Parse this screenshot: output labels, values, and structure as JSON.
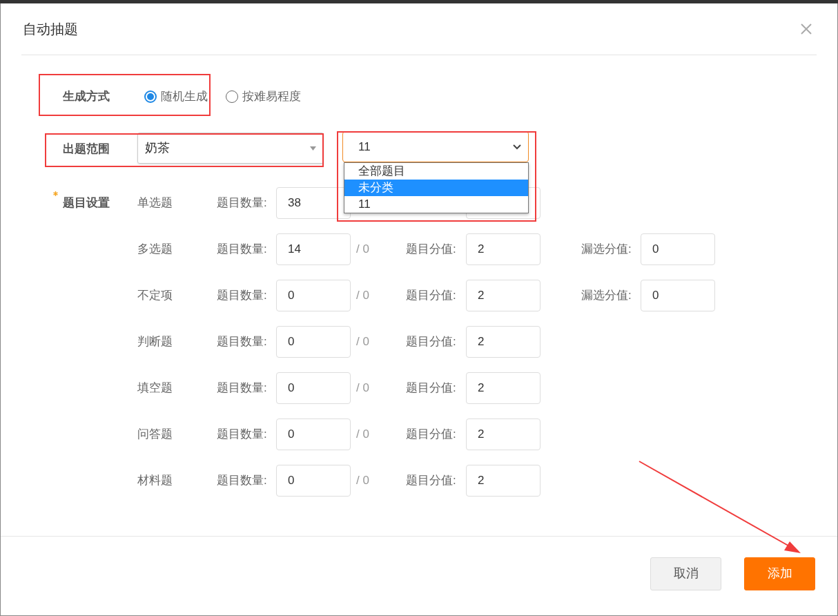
{
  "dialog": {
    "title": "自动抽题"
  },
  "mode": {
    "label": "生成方式",
    "options": [
      {
        "label": "随机生成",
        "selected": true
      },
      {
        "label": "按难易程度",
        "selected": false
      }
    ]
  },
  "scope": {
    "label": "出题范围",
    "bank_select": {
      "value": "奶茶"
    },
    "category_select": {
      "value": "11",
      "expanded": true,
      "options": [
        {
          "label": "全部题目",
          "highlighted": false
        },
        {
          "label": "未分类",
          "highlighted": true
        },
        {
          "label": "11",
          "highlighted": false
        }
      ]
    }
  },
  "questions": {
    "label": "题目设置",
    "required": true,
    "rows": [
      {
        "type": "单选题",
        "count_label": "题目数量:",
        "count": "38",
        "score_field": true
      },
      {
        "type": "多选题",
        "count_label": "题目数量:",
        "count": "14",
        "total": "/ 0",
        "score_label": "题目分值:",
        "score": "2",
        "partial_label": "漏选分值:",
        "partial": "0"
      },
      {
        "type": "不定项",
        "count_label": "题目数量:",
        "count": "0",
        "total": "/ 0",
        "score_label": "题目分值:",
        "score": "2",
        "partial_label": "漏选分值:",
        "partial": "0"
      },
      {
        "type": "判断题",
        "count_label": "题目数量:",
        "count": "0",
        "total": "/ 0",
        "score_label": "题目分值:",
        "score": "2"
      },
      {
        "type": "填空题",
        "count_label": "题目数量:",
        "count": "0",
        "total": "/ 0",
        "score_label": "题目分值:",
        "score": "2"
      },
      {
        "type": "问答题",
        "count_label": "题目数量:",
        "count": "0",
        "total": "/ 0",
        "score_label": "题目分值:",
        "score": "2"
      },
      {
        "type": "材料题",
        "count_label": "题目数量:",
        "count": "0",
        "total": "/ 0",
        "score_label": "题目分值:",
        "score": "2"
      }
    ]
  },
  "buttons": [
    {
      "label": "取消",
      "kind": "default"
    },
    {
      "label": "添加",
      "kind": "primary"
    }
  ]
}
